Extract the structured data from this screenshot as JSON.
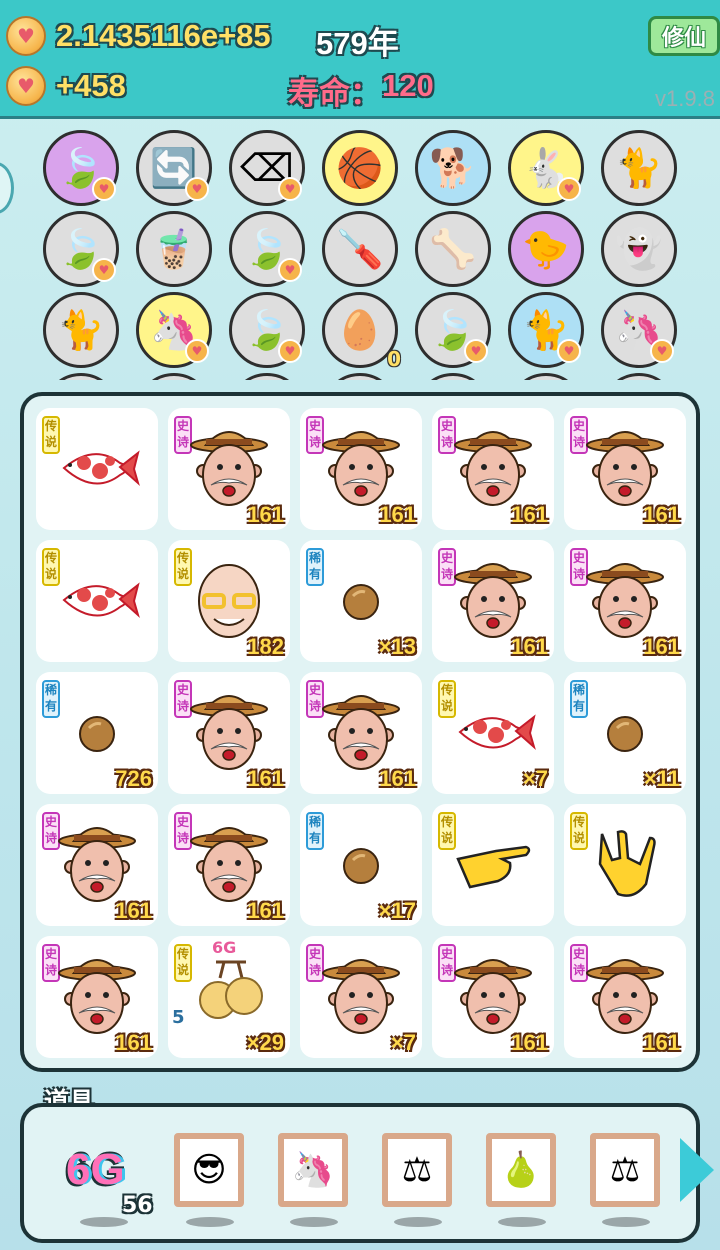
{
  "hud": {
    "gold_value": "2.1435116e+85",
    "years": "579年",
    "gold_rate": "+458",
    "lifespan_label": "寿命：",
    "lifespan_value": "120",
    "cultivate_button": "修仙",
    "version": "v1.9.8",
    "coin_icon": "gold-heart-coin-icon"
  },
  "roster": {
    "rows": [
      [
        {
          "icon": "leaf",
          "bg": "purple",
          "heart": true
        },
        {
          "icon": "refresh",
          "bg": "gray",
          "heart": true
        },
        {
          "icon": "delete-key",
          "bg": "gray",
          "heart": true
        },
        {
          "icon": "basketballs",
          "bg": "yellow",
          "heart": false
        },
        {
          "icon": "cool-dog",
          "bg": "blue",
          "heart": false
        },
        {
          "icon": "rabbit",
          "bg": "yellow",
          "heart": true
        },
        {
          "icon": "cats",
          "bg": "gray",
          "heart": false
        }
      ],
      [
        {
          "icon": "leaf",
          "bg": "gray",
          "heart": true
        },
        {
          "icon": "bubble-tea",
          "bg": "gray",
          "heart": false
        },
        {
          "icon": "leaf",
          "bg": "gray",
          "heart": true
        },
        {
          "icon": "screwdriver",
          "bg": "gray",
          "heart": false
        },
        {
          "icon": "dog-bowl",
          "bg": "gray",
          "heart": false
        },
        {
          "icon": "chick-egg",
          "bg": "purple",
          "heart": false
        },
        {
          "icon": "ghost",
          "bg": "gray",
          "heart": false
        }
      ],
      [
        {
          "icon": "cats",
          "bg": "gray",
          "heart": false
        },
        {
          "icon": "unicorn",
          "bg": "yellow",
          "heart": true
        },
        {
          "icon": "leaf",
          "bg": "gray",
          "heart": true
        },
        {
          "icon": "egg-tray",
          "bg": "gray",
          "heart": false,
          "count": "0"
        },
        {
          "icon": "leaf",
          "bg": "gray",
          "heart": true
        },
        {
          "icon": "cat",
          "bg": "blue",
          "heart": true
        },
        {
          "icon": "unicorns",
          "bg": "gray",
          "heart": true
        }
      ]
    ]
  },
  "rarity": {
    "legend": "传说",
    "epic": "史诗",
    "rare": "稀有"
  },
  "bag": [
    {
      "rarity": "legend",
      "art": "koi-fish",
      "qty": ""
    },
    {
      "rarity": "epic",
      "art": "farmer",
      "qty": "161"
    },
    {
      "rarity": "epic",
      "art": "farmer",
      "qty": "161"
    },
    {
      "rarity": "epic",
      "art": "farmer",
      "qty": "161"
    },
    {
      "rarity": "epic",
      "art": "farmer",
      "qty": "161"
    },
    {
      "rarity": "legend",
      "art": "koi-fish",
      "qty": ""
    },
    {
      "rarity": "legend",
      "art": "bald-man",
      "qty": "182"
    },
    {
      "rarity": "rare",
      "art": "nut",
      "qty": "×13"
    },
    {
      "rarity": "epic",
      "art": "farmer",
      "qty": "161"
    },
    {
      "rarity": "epic",
      "art": "farmer",
      "qty": "161"
    },
    {
      "rarity": "rare",
      "art": "nut",
      "qty": "726"
    },
    {
      "rarity": "epic",
      "art": "farmer",
      "qty": "161"
    },
    {
      "rarity": "epic",
      "art": "farmer",
      "qty": "161"
    },
    {
      "rarity": "legend",
      "art": "koi-fish",
      "qty": "×7"
    },
    {
      "rarity": "rare",
      "art": "nut",
      "qty": "×11"
    },
    {
      "rarity": "epic",
      "art": "farmer",
      "qty": "161"
    },
    {
      "rarity": "epic",
      "art": "farmer",
      "qty": "161"
    },
    {
      "rarity": "rare",
      "art": "nut",
      "qty": "×17"
    },
    {
      "rarity": "legend",
      "art": "pointing-hand",
      "qty": ""
    },
    {
      "rarity": "legend",
      "art": "rock-hand",
      "qty": ""
    },
    {
      "rarity": "epic",
      "art": "farmer",
      "qty": "161"
    },
    {
      "rarity": "legend",
      "art": "golden-fruit",
      "qty": "×29",
      "top": "6G",
      "level": "5"
    },
    {
      "rarity": "epic",
      "art": "farmer",
      "qty": "×7"
    },
    {
      "rarity": "epic",
      "art": "farmer",
      "qty": "161"
    },
    {
      "rarity": "epic",
      "art": "farmer",
      "qty": "161"
    }
  ],
  "props": {
    "label": "道具",
    "sixg_label": "6G",
    "sixg_count": "56",
    "items": [
      {
        "icon": "sunglasses-man"
      },
      {
        "icon": "unicorn"
      },
      {
        "icon": "scale"
      },
      {
        "icon": "pear"
      },
      {
        "icon": "scale"
      }
    ],
    "next_icon": "chevron-right-icon"
  },
  "colors": {
    "hud": "#3cc8c8",
    "bag_border": "#1d3337",
    "qty_text": "#ffd94a",
    "pink": "#ff6b8a"
  }
}
